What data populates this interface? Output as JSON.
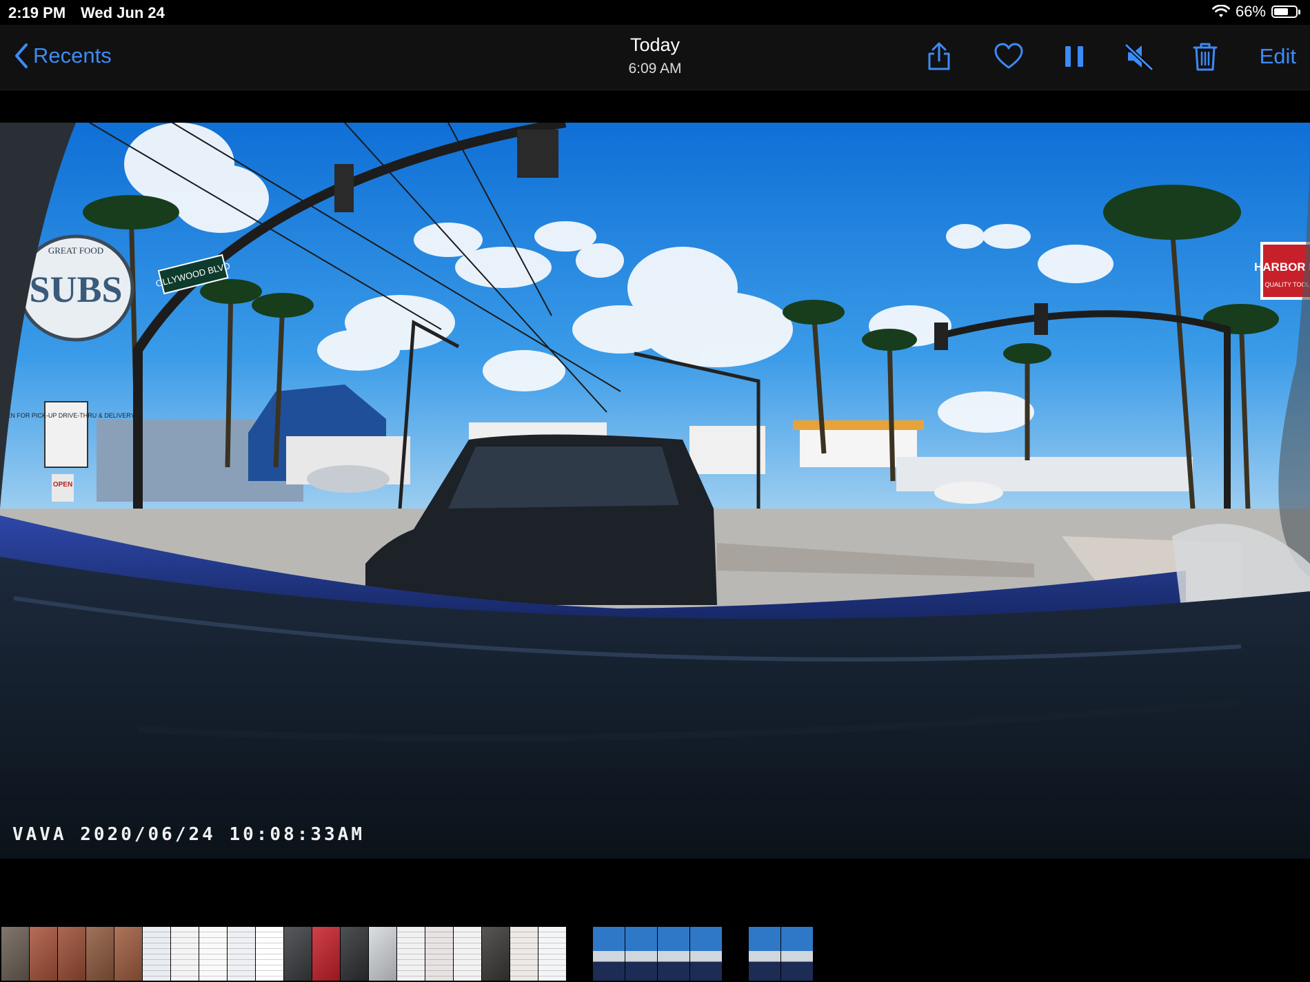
{
  "status": {
    "time": "2:19 PM",
    "date": "Wed Jun 24",
    "battery_percent": "66%",
    "battery_level": 0.66
  },
  "nav": {
    "back_label": "Recents",
    "title": "Today",
    "subtitle": "6:09 AM",
    "edit_label": "Edit",
    "icons": [
      "share-icon",
      "heart-icon",
      "pause-icon",
      "speaker-muted-icon",
      "trash-icon"
    ]
  },
  "photo": {
    "overlay_text": "VAVA 2020/06/24 10:08:33AM",
    "sign_street": "OLLYWOOD BLVD",
    "sign_subs_top": "GREAT FOOD",
    "sign_subs": "SUBS",
    "sign_open_for": "OPEN FOR PICK-UP DRIVE-THRU & DELIVERY",
    "sign_open": "OPEN",
    "sign_harbor": "HARBOR FR",
    "sign_harbor_sub": "QUALITY TOOLS"
  },
  "filmstrip": {
    "thumbnails": [
      {
        "kind": "photo",
        "color": "#6b5f55"
      },
      {
        "kind": "photo",
        "color": "#a8533a"
      },
      {
        "kind": "photo",
        "color": "#9c4e35"
      },
      {
        "kind": "photo",
        "color": "#8f5a3e"
      },
      {
        "kind": "photo",
        "color": "#a05c3f"
      },
      {
        "kind": "doc",
        "color": "#e9edf2"
      },
      {
        "kind": "doc",
        "color": "#f4f4f4"
      },
      {
        "kind": "doc",
        "color": "#fafafa"
      },
      {
        "kind": "doc",
        "color": "#eef0f3"
      },
      {
        "kind": "doc",
        "color": "#ffffff"
      },
      {
        "kind": "photo",
        "color": "#3a3d40"
      },
      {
        "kind": "photo",
        "color": "#c8202a"
      },
      {
        "kind": "photo",
        "color": "#2f3134"
      },
      {
        "kind": "photo",
        "color": "#d5d9dd"
      },
      {
        "kind": "doc",
        "color": "#f1f1f1"
      },
      {
        "kind": "doc",
        "color": "#e7e3e3"
      },
      {
        "kind": "doc",
        "color": "#f2f2f2"
      },
      {
        "kind": "photo",
        "color": "#3a3937"
      },
      {
        "kind": "doc",
        "color": "#ece9e6"
      },
      {
        "kind": "doc",
        "color": "#f3f5f7"
      },
      {
        "kind": "gap"
      },
      {
        "kind": "video",
        "color": "#4e7aa6"
      },
      {
        "kind": "video",
        "color": "#5b8ab8"
      },
      {
        "kind": "video",
        "color": "#4f86bd"
      },
      {
        "kind": "video",
        "color": "#5a8fc2"
      },
      {
        "kind": "gap"
      },
      {
        "kind": "video",
        "color": "#2f4d7a"
      },
      {
        "kind": "video",
        "color": "#5a8fc2"
      }
    ]
  }
}
